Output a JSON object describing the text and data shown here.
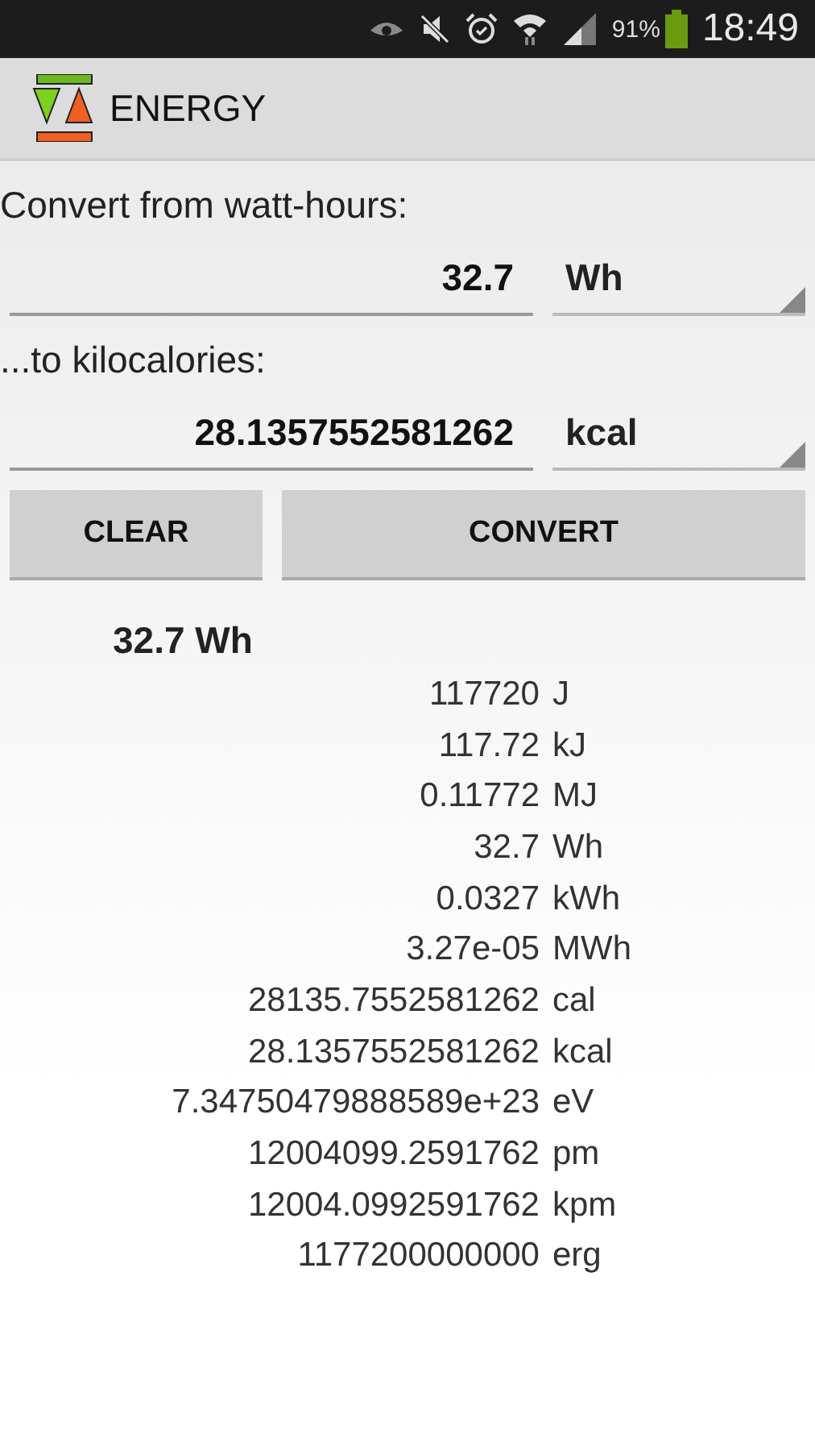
{
  "status_bar": {
    "battery": "91%",
    "time": "18:49"
  },
  "action_bar": {
    "title": "ENERGY"
  },
  "from": {
    "label": "Convert from watt-hours:",
    "value": "32.7",
    "unit": "Wh"
  },
  "to": {
    "label": "...to kilocalories:",
    "value": "28.1357552581262",
    "unit": "kcal"
  },
  "buttons": [
    "CLEAR",
    "CONVERT"
  ],
  "results": {
    "heading": "32.7 Wh",
    "rows": [
      {
        "value": "117720",
        "unit": "J"
      },
      {
        "value": "117.72",
        "unit": "kJ"
      },
      {
        "value": "0.11772",
        "unit": "MJ"
      },
      {
        "value": "32.7",
        "unit": "Wh"
      },
      {
        "value": "0.0327",
        "unit": "kWh"
      },
      {
        "value": "3.27e-05",
        "unit": "MWh"
      },
      {
        "value": "28135.7552581262",
        "unit": "cal"
      },
      {
        "value": "28.1357552581262",
        "unit": "kcal"
      },
      {
        "value": "7.34750479888589e+23",
        "unit": "eV"
      },
      {
        "value": "12004099.2591762",
        "unit": "pm"
      },
      {
        "value": "12004.0992591762",
        "unit": "kpm"
      },
      {
        "value": "1177200000000",
        "unit": "erg"
      }
    ]
  }
}
